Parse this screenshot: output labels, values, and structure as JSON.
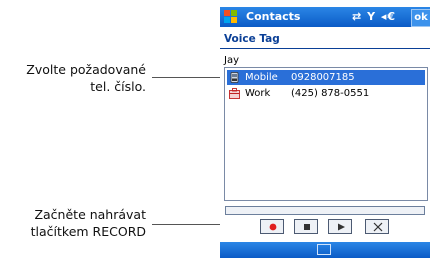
{
  "annotations": {
    "choose_number": [
      "Zvolte požadované",
      "tel. číslo."
    ],
    "start_recording": [
      "Začněte nahrávat",
      "tlačítkem RECORD"
    ]
  },
  "titlebar": {
    "app_title": "Contacts",
    "ok_label": "ok",
    "status_icons": "⇄ Y̆ ◂€"
  },
  "screen": {
    "title": "Voice Tag",
    "contact_name": "Jay"
  },
  "numbers": [
    {
      "label": "Mobile",
      "number": "0928007185",
      "selected": true,
      "icon": "mobile-phone-icon"
    },
    {
      "label": "Work",
      "number": "(425) 878-0551",
      "selected": false,
      "icon": "work-phone-icon"
    }
  ],
  "controls": {
    "buttons": [
      "record",
      "stop",
      "play",
      "delete"
    ],
    "progress": 0
  },
  "colors": {
    "titlebar": "#0b5bc6",
    "selection": "#2a6fd8",
    "record_red": "#e02020",
    "heading": "#0a3f96"
  }
}
